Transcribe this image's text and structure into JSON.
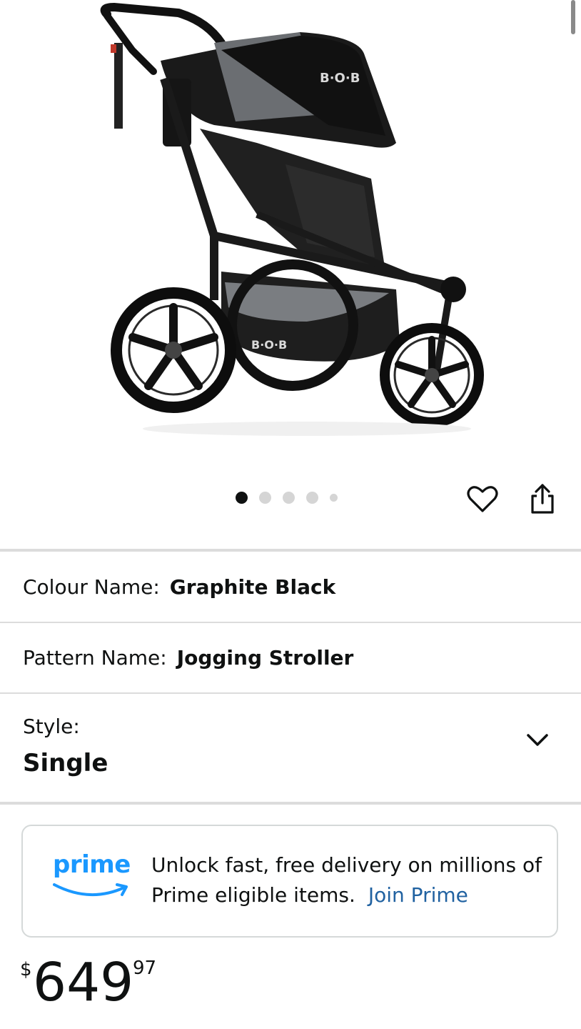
{
  "product": {
    "image_brand_text": "B·O·B",
    "gallery": {
      "total": 5,
      "active": 1
    }
  },
  "attributes": {
    "colour": {
      "label": "Colour Name:",
      "value": "Graphite Black"
    },
    "pattern": {
      "label": "Pattern Name:",
      "value": "Jogging Stroller"
    },
    "style": {
      "label": "Style:",
      "value": "Single"
    }
  },
  "prime": {
    "logo_text": "prime",
    "message": "Unlock fast, free delivery on millions of Prime eligible items.",
    "link_label": "Join Prime"
  },
  "price": {
    "symbol": "$",
    "whole": "649",
    "fraction": "97"
  },
  "icons": {
    "favorite": "heart-icon",
    "share": "share-icon",
    "style_dropdown": "chevron-down-icon"
  },
  "colors": {
    "prime_blue": "#1a98ff",
    "link_blue": "#2162a1",
    "text": "#0f1111",
    "divider": "#dcdcdc"
  }
}
